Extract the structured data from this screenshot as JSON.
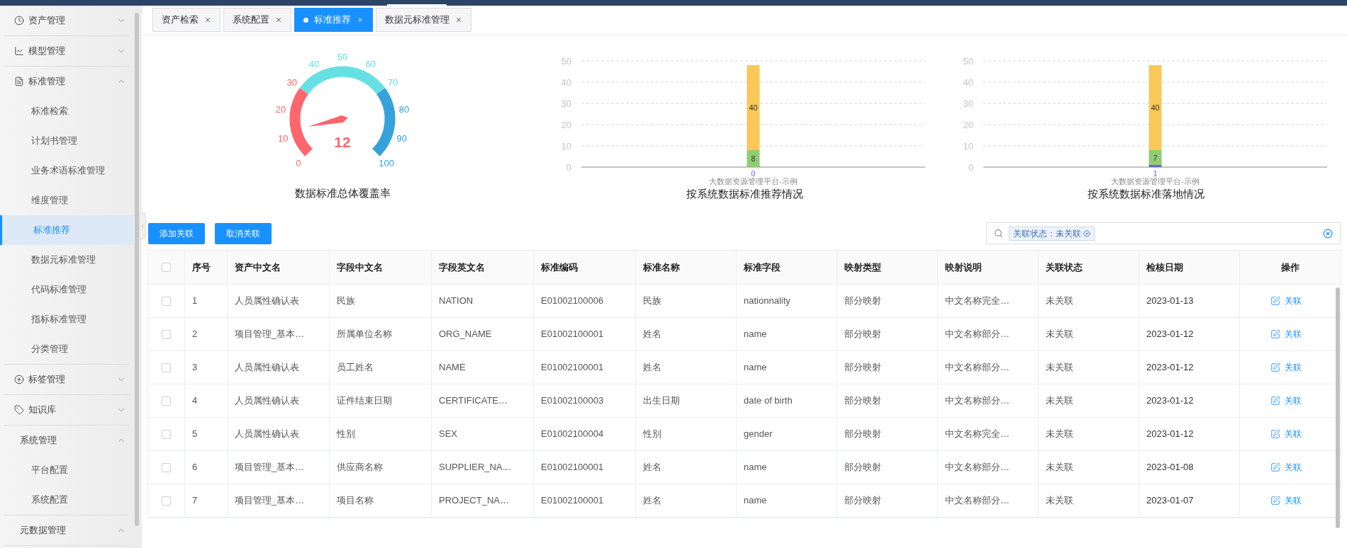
{
  "sidebar": {
    "items": [
      {
        "label": "资产管理",
        "expanded": false
      },
      {
        "label": "模型管理",
        "expanded": false
      },
      {
        "label": "标准管理",
        "expanded": true,
        "children": [
          {
            "label": "标准检索",
            "selected": false
          },
          {
            "label": "计划书管理",
            "selected": false
          },
          {
            "label": "业务术语标准管理",
            "selected": false
          },
          {
            "label": "维度管理",
            "selected": false
          },
          {
            "label": "标准推荐",
            "selected": true
          },
          {
            "label": "数据元标准管理",
            "selected": false
          },
          {
            "label": "代码标准管理",
            "selected": false
          },
          {
            "label": "指标标准管理",
            "selected": false
          },
          {
            "label": "分类管理",
            "selected": false
          }
        ]
      },
      {
        "label": "标签管理",
        "expanded": false
      },
      {
        "label": "知识库",
        "expanded": false
      },
      {
        "label": "系统管理",
        "expanded": true,
        "children": [
          {
            "label": "平台配置",
            "selected": false
          },
          {
            "label": "系统配置",
            "selected": false
          }
        ]
      },
      {
        "label": "元数据管理",
        "expanded": true
      }
    ]
  },
  "tabs": [
    {
      "label": "资产检索",
      "selected": false
    },
    {
      "label": "系统配置",
      "selected": false
    },
    {
      "label": "标准推荐",
      "selected": true
    },
    {
      "label": "数据元标准管理",
      "selected": false
    }
  ],
  "gauge": {
    "title": "数据标准总体覆盖率",
    "value": "12",
    "ticks": [
      {
        "label": "0",
        "color": "#fd666d"
      },
      {
        "label": "10",
        "color": "#fd666d"
      },
      {
        "label": "20",
        "color": "#fd666d"
      },
      {
        "label": "30",
        "color": "#fd666d"
      },
      {
        "label": "40",
        "color": "#67e0e3"
      },
      {
        "label": "50",
        "color": "#67e0e3"
      },
      {
        "label": "60",
        "color": "#67e0e3"
      },
      {
        "label": "70",
        "color": "#67e0e3"
      },
      {
        "label": "80",
        "color": "#37a2da"
      },
      {
        "label": "90",
        "color": "#37a2da"
      },
      {
        "label": "100",
        "color": "#37a2da"
      }
    ]
  },
  "charts": [
    {
      "title": "按系统数据标准推荐情况",
      "chart_data": {
        "type": "bar",
        "stacked": true,
        "grid": true,
        "categories": [
          "大数据资源管理平台-示例"
        ],
        "ylim": [
          0,
          50
        ],
        "yticks": [
          0,
          10,
          20,
          30,
          40,
          50
        ],
        "data_labels": true,
        "series": [
          {
            "color": "#5470c6",
            "values": [
              0
            ]
          },
          {
            "color": "#91cc75",
            "values": [
              8
            ]
          },
          {
            "color": "#fac858",
            "values": [
              40
            ]
          }
        ]
      }
    },
    {
      "title": "按系统数据标准落地情况",
      "chart_data": {
        "type": "bar",
        "stacked": true,
        "grid": true,
        "categories": [
          "大数据资源管理平台-示例"
        ],
        "ylim": [
          0,
          50
        ],
        "yticks": [
          0,
          10,
          20,
          30,
          40,
          50
        ],
        "data_labels": true,
        "series": [
          {
            "color": "#5470c6",
            "values": [
              1
            ]
          },
          {
            "color": "#91cc75",
            "values": [
              7
            ]
          },
          {
            "color": "#fac858",
            "values": [
              40
            ]
          }
        ]
      }
    }
  ],
  "buttons": [
    "添加关联",
    "取消关联"
  ],
  "search": {
    "filter_tag": "关联状态：未关联"
  },
  "table": {
    "select_all": {
      "checked": false
    },
    "columns": [
      "序号",
      "资产中文名",
      "字段中文名",
      "字段英文名",
      "标准编码",
      "标准名称",
      "标准字段",
      "映射类型",
      "映射说明",
      "关联状态",
      "检核日期",
      "操作"
    ],
    "rows": [
      {
        "checked": false,
        "cells": [
          "1",
          "人员属性确认表",
          "民族",
          "NATION",
          "E01002100006",
          "民族",
          "nationnality",
          "部分映射",
          "中文名称完全…",
          "未关联",
          "2023-01-13"
        ],
        "action": "关联"
      },
      {
        "checked": false,
        "cells": [
          "2",
          "项目管理_基本…",
          "所属单位名称",
          "ORG_NAME",
          "E01002100001",
          "姓名",
          "name",
          "部分映射",
          "中文名称部分…",
          "未关联",
          "2023-01-12"
        ],
        "action": "关联"
      },
      {
        "checked": false,
        "cells": [
          "3",
          "人员属性确认表",
          "员工姓名",
          "NAME",
          "E01002100001",
          "姓名",
          "name",
          "部分映射",
          "中文名称部分…",
          "未关联",
          "2023-01-12"
        ],
        "action": "关联"
      },
      {
        "checked": false,
        "cells": [
          "4",
          "人员属性确认表",
          "证件结束日期",
          "CERTIFICATE…",
          "E01002100003",
          "出生日期",
          "date of birth",
          "部分映射",
          "中文名称部分…",
          "未关联",
          "2023-01-12"
        ],
        "action": "关联"
      },
      {
        "checked": false,
        "cells": [
          "5",
          "人员属性确认表",
          "性别",
          "SEX",
          "E01002100004",
          "性别",
          "gender",
          "部分映射",
          "中文名称完全…",
          "未关联",
          "2023-01-12"
        ],
        "action": "关联"
      },
      {
        "checked": false,
        "cells": [
          "6",
          "项目管理_基本…",
          "供应商名称",
          "SUPPLIER_NA…",
          "E01002100001",
          "姓名",
          "name",
          "部分映射",
          "中文名称部分…",
          "未关联",
          "2023-01-08"
        ],
        "action": "关联"
      },
      {
        "checked": false,
        "cells": [
          "7",
          "项目管理_基本…",
          "项目名称",
          "PROJECT_NA…",
          "E01002100001",
          "姓名",
          "name",
          "部分映射",
          "中文名称部分…",
          "未关联",
          "2023-01-07"
        ],
        "action": "关联"
      }
    ]
  }
}
